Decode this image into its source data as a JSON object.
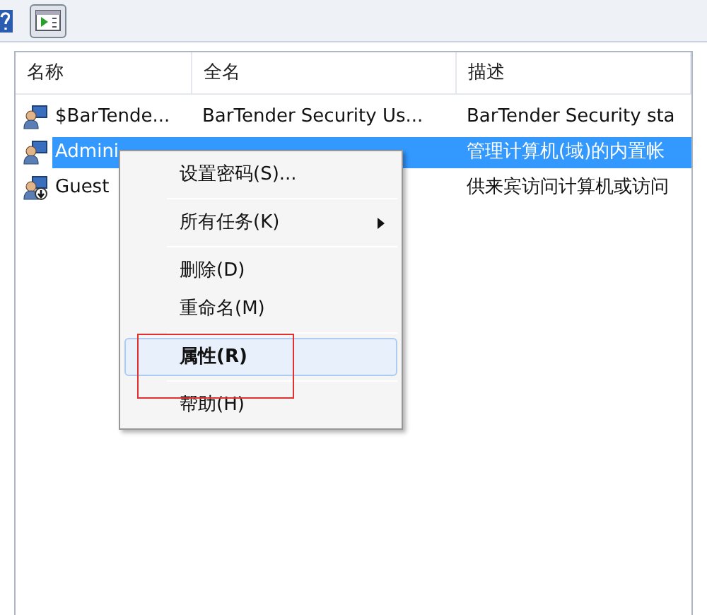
{
  "columns": [
    "名称",
    "全名",
    "描述"
  ],
  "rows": [
    {
      "name": "$BarTende...",
      "full_name": "BarTender Security Us...",
      "description": "BarTender Security sta",
      "selected": false,
      "disabled": false
    },
    {
      "name": "Admini",
      "full_name": "",
      "description": "管理计算机(域)的内置帐",
      "selected": true,
      "disabled": false
    },
    {
      "name": "Guest",
      "full_name": "",
      "description": "供来宾访问计算机或访问",
      "selected": false,
      "disabled": true
    }
  ],
  "context_menu": [
    {
      "kind": "item",
      "label": "设置密码(S)...",
      "selected": false,
      "default": false
    },
    {
      "kind": "separator"
    },
    {
      "kind": "submenu",
      "label": "所有任务(K)",
      "selected": false,
      "default": false
    },
    {
      "kind": "separator"
    },
    {
      "kind": "item",
      "label": "删除(D)",
      "selected": false,
      "default": false
    },
    {
      "kind": "item",
      "label": "重命名(M)",
      "selected": false,
      "default": false
    },
    {
      "kind": "separator"
    },
    {
      "kind": "item",
      "label": "属性(R)",
      "selected": true,
      "default": true
    },
    {
      "kind": "separator"
    },
    {
      "kind": "item",
      "label": "帮助(H)",
      "selected": false,
      "default": false
    }
  ]
}
